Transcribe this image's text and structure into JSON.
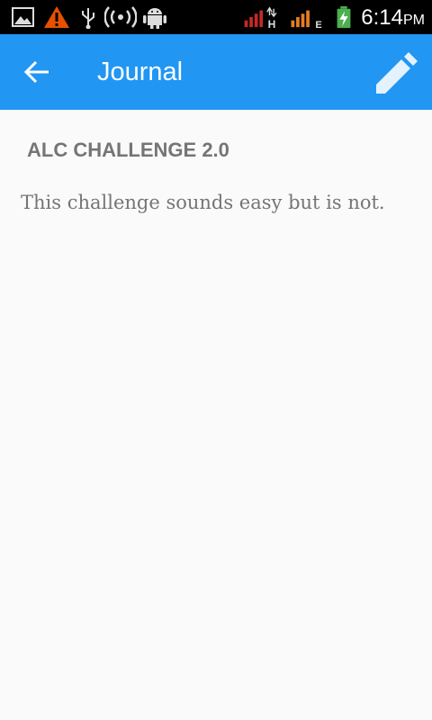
{
  "status_bar": {
    "icons": [
      "image-icon",
      "warning-icon",
      "usb-icon",
      "hotspot-icon",
      "android-icon",
      "signal-h-icon",
      "signal-e-icon",
      "battery-charging-icon"
    ],
    "network_labels": [
      "H",
      "E"
    ],
    "time": "6:14",
    "ampm": "PM"
  },
  "app_bar": {
    "title": "Journal",
    "color": "#2196f3",
    "back_icon": "arrow-back-icon",
    "action_icon": "pencil-icon"
  },
  "entry": {
    "title": "ALC CHALLENGE 2.0",
    "body": "This challenge sounds easy but is not."
  }
}
